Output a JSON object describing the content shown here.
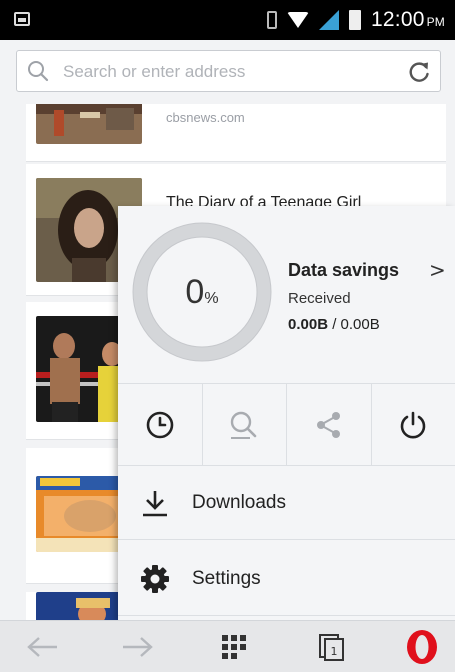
{
  "status_bar": {
    "time": "12:00",
    "ampm": "PM"
  },
  "address_bar": {
    "placeholder": "Search or enter address"
  },
  "feed": [
    {
      "source": "cbsnews.com",
      "headline": ""
    },
    {
      "source": "",
      "headline": "The Diary of a Teenage Girl"
    },
    {
      "source": "",
      "headline": ""
    },
    {
      "source": "",
      "headline": ""
    },
    {
      "source": "",
      "headline": ""
    }
  ],
  "menu": {
    "data_savings": {
      "percent": "0",
      "percent_symbol": "%",
      "title": "Data savings",
      "chevron": ">",
      "received_label": "Received",
      "received_value": "0.00B",
      "separator": " / ",
      "total_value": "0.00B"
    },
    "quick_actions": [
      "history-icon",
      "find-in-page-icon",
      "share-icon",
      "power-icon"
    ],
    "items": [
      {
        "label": "Downloads",
        "icon": "download-icon"
      },
      {
        "label": "Settings",
        "icon": "gear-icon"
      }
    ]
  },
  "bottom_bar": {
    "buttons": [
      "back-arrow-icon",
      "forward-arrow-icon",
      "speed-dial-grid-icon",
      "tabs-icon",
      "opera-menu-icon"
    ],
    "tabs_count": "1",
    "brand_color": "#e0101c"
  }
}
